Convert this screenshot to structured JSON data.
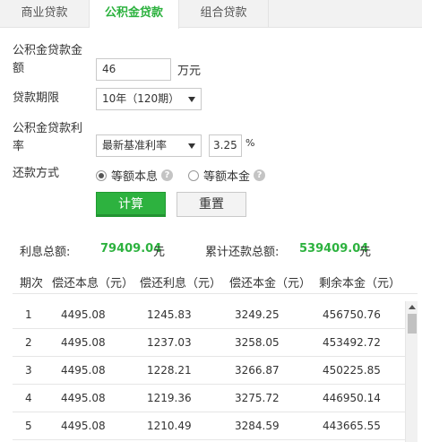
{
  "tabs": [
    {
      "label": "商业贷款",
      "active": false
    },
    {
      "label": "公积金贷款",
      "active": true
    },
    {
      "label": "组合贷款",
      "active": false
    }
  ],
  "form": {
    "amount_label_1": "公积金贷款金",
    "amount_label_2": "额",
    "amount_value": "46",
    "amount_unit": "万元",
    "term_label": "贷款期限",
    "term_value": "10年（120期）",
    "rate_label_1": "公积金贷款利",
    "rate_label_2": "率",
    "rate_type": "最新基准利率",
    "rate_value": "3.25",
    "rate_unit": "%",
    "method_label": "还款方式",
    "method_options": [
      {
        "label": "等额本息",
        "selected": true
      },
      {
        "label": "等额本金",
        "selected": false
      }
    ],
    "help_glyph": "?",
    "calc_label": "计算",
    "reset_label": "重置"
  },
  "summary": {
    "interest_label": "利息总额:",
    "interest_value": "79409.04",
    "interest_unit": "元",
    "total_label": "累计还款总额:",
    "total_value": "539409.04",
    "total_unit": "元"
  },
  "table": {
    "headers": [
      "期次",
      "偿还本息（元）",
      "偿还利息（元）",
      "偿还本金（元）",
      "剩余本金（元）"
    ],
    "rows": [
      [
        "1",
        "4495.08",
        "1245.83",
        "3249.25",
        "456750.76"
      ],
      [
        "2",
        "4495.08",
        "1237.03",
        "3258.05",
        "453492.72"
      ],
      [
        "3",
        "4495.08",
        "1228.21",
        "3266.87",
        "450225.85"
      ],
      [
        "4",
        "4495.08",
        "1219.36",
        "3275.72",
        "446950.14"
      ],
      [
        "5",
        "4495.08",
        "1210.49",
        "3284.59",
        "443665.55"
      ]
    ]
  },
  "colors": {
    "accent": "#2db23f"
  }
}
